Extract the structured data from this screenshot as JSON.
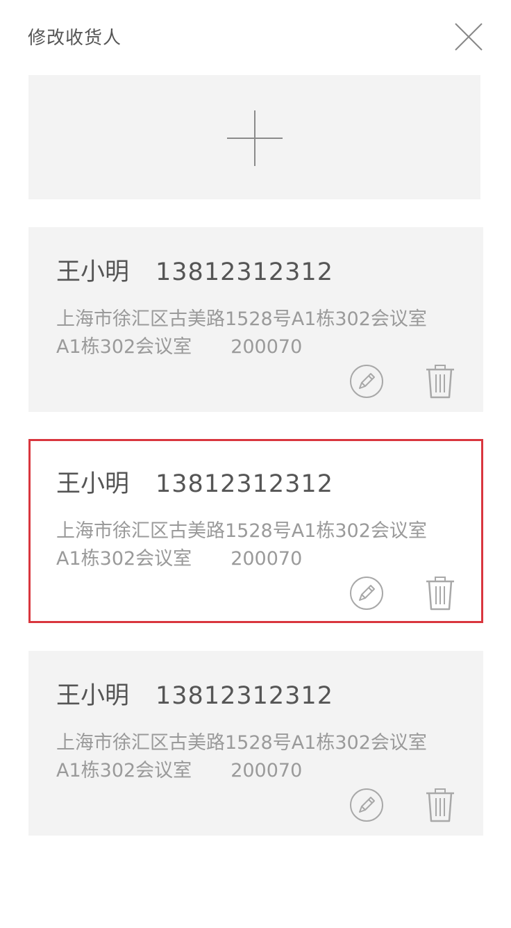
{
  "header": {
    "title": "修改收货人",
    "close_icon": "close-icon"
  },
  "add_card": {
    "icon": "plus-icon"
  },
  "addresses": [
    {
      "name": "王小明",
      "phone": "13812312312",
      "address_line1": "上海市徐汇区古美路1528号A1栋302会议室",
      "address_line2": "A1栋302会议室",
      "zip": "200070",
      "selected": false
    },
    {
      "name": "王小明",
      "phone": "13812312312",
      "address_line1": "上海市徐汇区古美路1528号A1栋302会议室",
      "address_line2": "A1栋302会议室",
      "zip": "200070",
      "selected": true
    },
    {
      "name": "王小明",
      "phone": "13812312312",
      "address_line1": "上海市徐汇区古美路1528号A1栋302会议室",
      "address_line2": "A1栋302会议室",
      "zip": "200070",
      "selected": false
    }
  ],
  "icons": {
    "edit": "pencil-icon",
    "delete": "trash-icon"
  },
  "colors": {
    "selected_border": "#d9363e",
    "card_background": "#f3f3f3",
    "icon_gray": "#a8a8a8"
  }
}
